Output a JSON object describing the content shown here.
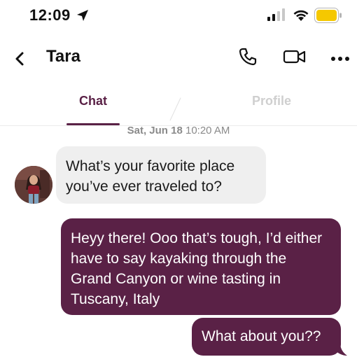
{
  "status_bar": {
    "time": "12:09",
    "icons": [
      "location-arrow-icon",
      "signal-icon",
      "wifi-icon",
      "battery-icon"
    ]
  },
  "header": {
    "contact_name": "Tara",
    "icons": [
      "back-chevron-icon",
      "phone-icon",
      "video-camera-icon",
      "more-icon"
    ]
  },
  "tabs": [
    {
      "label": "Chat",
      "active": true
    },
    {
      "label": "Profile",
      "active": false
    }
  ],
  "date_stamp": {
    "day": "Sat, Jun 18",
    "time": "10:20 AM"
  },
  "messages": [
    {
      "direction": "incoming",
      "text": "What’s your favorite place you’ve ever traveled to?"
    },
    {
      "direction": "outgoing",
      "text": "Heyy there! Ooo that’s tough, I’d either have to say kayaking through the Grand Canyon or wine tasting in Tuscany, Italy"
    },
    {
      "direction": "outgoing",
      "text": "What about you??"
    }
  ],
  "colors": {
    "accent": "#5a2146",
    "incoming_bubble": "#efefef",
    "inactive_tab": "#cfcfcf",
    "battery": "#f5c800"
  }
}
